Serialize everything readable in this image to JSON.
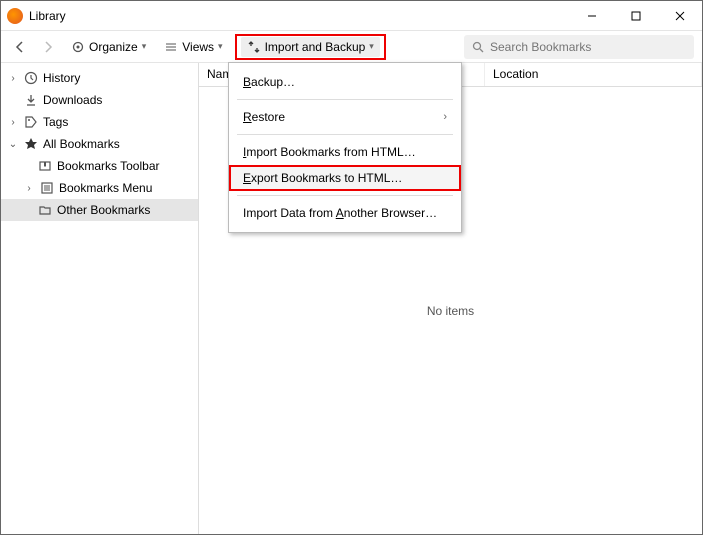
{
  "window": {
    "title": "Library"
  },
  "toolbar": {
    "organize": "Organize",
    "views": "Views",
    "import_backup": "Import and Backup"
  },
  "search": {
    "placeholder": "Search Bookmarks"
  },
  "sidebar": {
    "history": "History",
    "downloads": "Downloads",
    "tags": "Tags",
    "all_bookmarks": "All Bookmarks",
    "toolbar": "Bookmarks Toolbar",
    "menu": "Bookmarks Menu",
    "other": "Other Bookmarks"
  },
  "columns": {
    "name": "Name",
    "location": "Location"
  },
  "list": {
    "empty": "No items"
  },
  "menu": {
    "backup": "ackup…",
    "backup_prefix": "B",
    "restore": "estore",
    "restore_prefix": "R",
    "import_html": "mport Bookmarks from HTML…",
    "import_html_prefix": "I",
    "export_html": "xport Bookmarks to HTML…",
    "export_html_prefix": "E",
    "import_other": "Import Data from ",
    "import_other_underline": "A",
    "import_other_suffix": "nother Browser…"
  }
}
